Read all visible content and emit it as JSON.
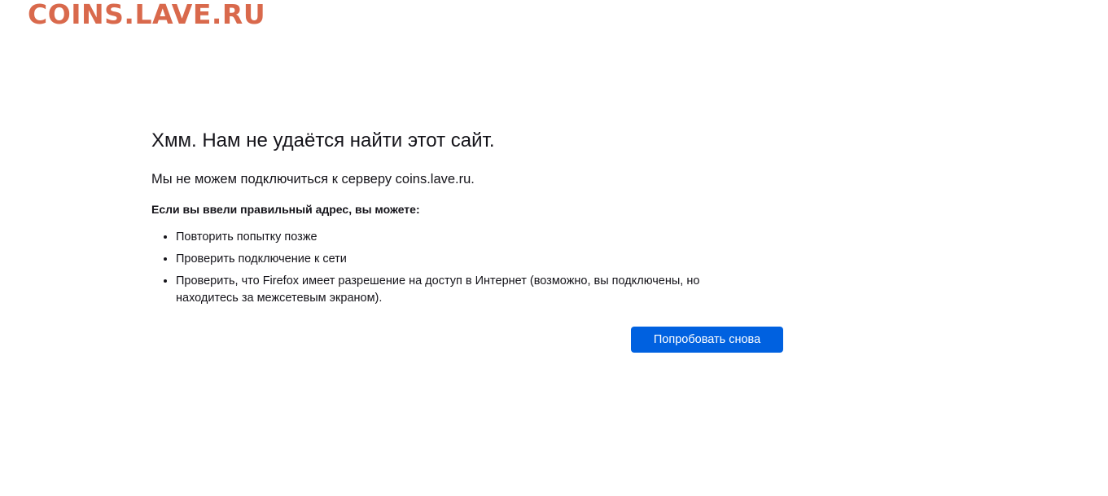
{
  "watermark": {
    "text": "COINS.LAVE.RU",
    "color": "#d9694c"
  },
  "error_page": {
    "title": "Хмм. Нам не удаётся найти этот сайт.",
    "subtitle": "Мы не можем подключиться к серверу coins.lave.ru.",
    "hint_heading": "Если вы ввели правильный адрес, вы можете:",
    "suggestions": [
      "Повторить попытку позже",
      "Проверить подключение к сети",
      "Проверить, что Firefox имеет разрешение на доступ в Интернет (возможно, вы подключены, но находитесь за межсетевым экраном)."
    ],
    "retry_button_label": "Попробовать снова"
  },
  "colors": {
    "text": "#15141a",
    "button_bg": "#0061e0",
    "button_text": "#ffffff",
    "background": "#ffffff"
  }
}
